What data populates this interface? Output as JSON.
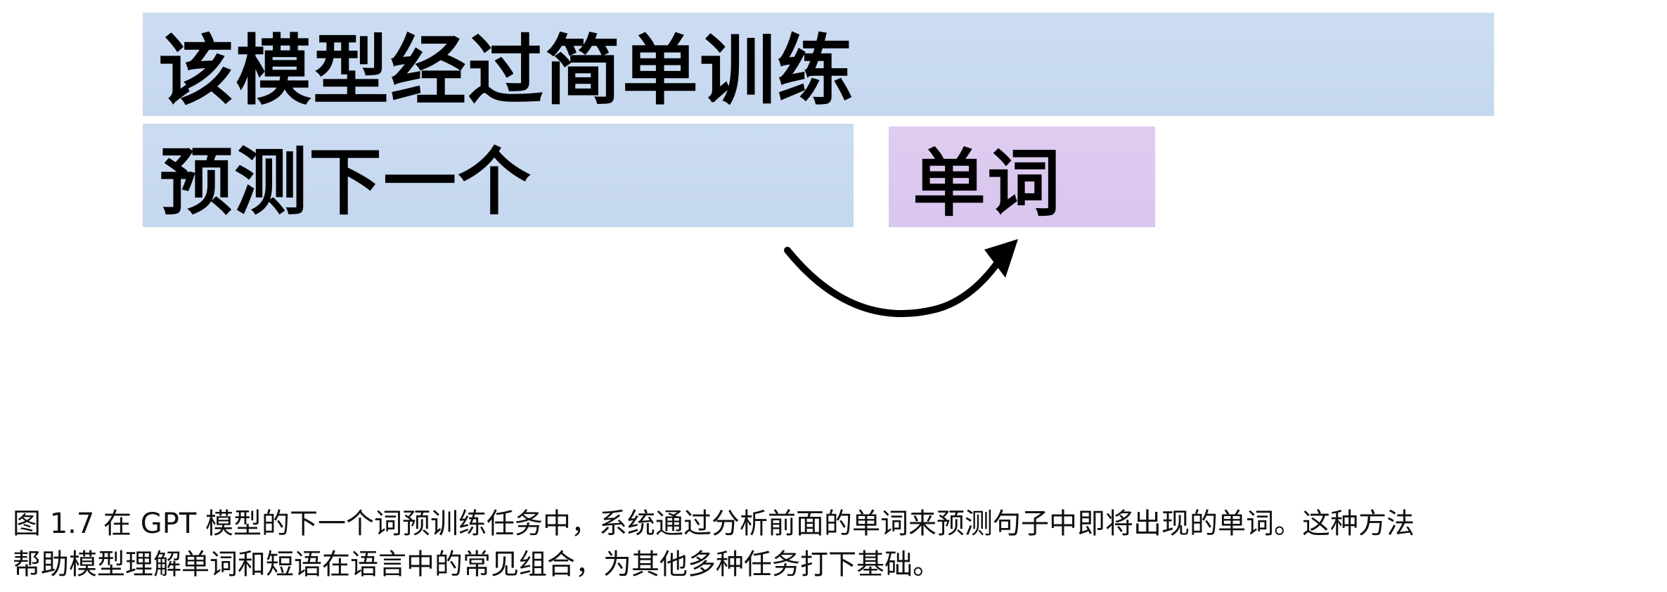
{
  "diagram": {
    "input_text": "该模型经过简单训练",
    "context_text": "预测下一个",
    "target_text": "单词"
  },
  "caption": {
    "line1": "图 1.7 在 GPT 模型的下一个词预训练任务中，系统通过分析前面的单词来预测句子中即将出现的单词。这种方法",
    "line2": "帮助模型理解单词和短语在语言中的常见组合，为其他多种任务打下基础。"
  },
  "colors": {
    "input_block": "#c8daf1",
    "target_block": "#dcc9f0",
    "arrow": "#000000",
    "text": "#000000"
  }
}
